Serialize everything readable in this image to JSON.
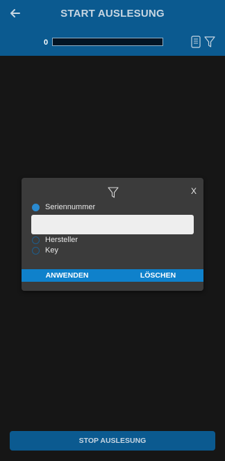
{
  "header": {
    "title": "START AUSLESUNG",
    "count": "0",
    "progress_fraction": 0
  },
  "icons": {
    "back": "arrow-left-icon",
    "device": "device-icon",
    "filter": "filter-icon"
  },
  "dialog": {
    "close_label": "X",
    "options": [
      {
        "label": "Seriennummer",
        "checked": true
      },
      {
        "label": "Hersteller",
        "checked": false
      },
      {
        "label": "Key",
        "checked": false
      }
    ],
    "input_value": "",
    "input_placeholder": "",
    "apply_label": "ANWENDEN",
    "clear_label": "LÖSCHEN"
  },
  "footer": {
    "stop_label": "STOP AUSLESUNG"
  },
  "colors": {
    "header_bg": "#0b5a90",
    "accent": "#0f81cb",
    "background": "#161616",
    "dialog_bg": "#3b3b3b"
  }
}
